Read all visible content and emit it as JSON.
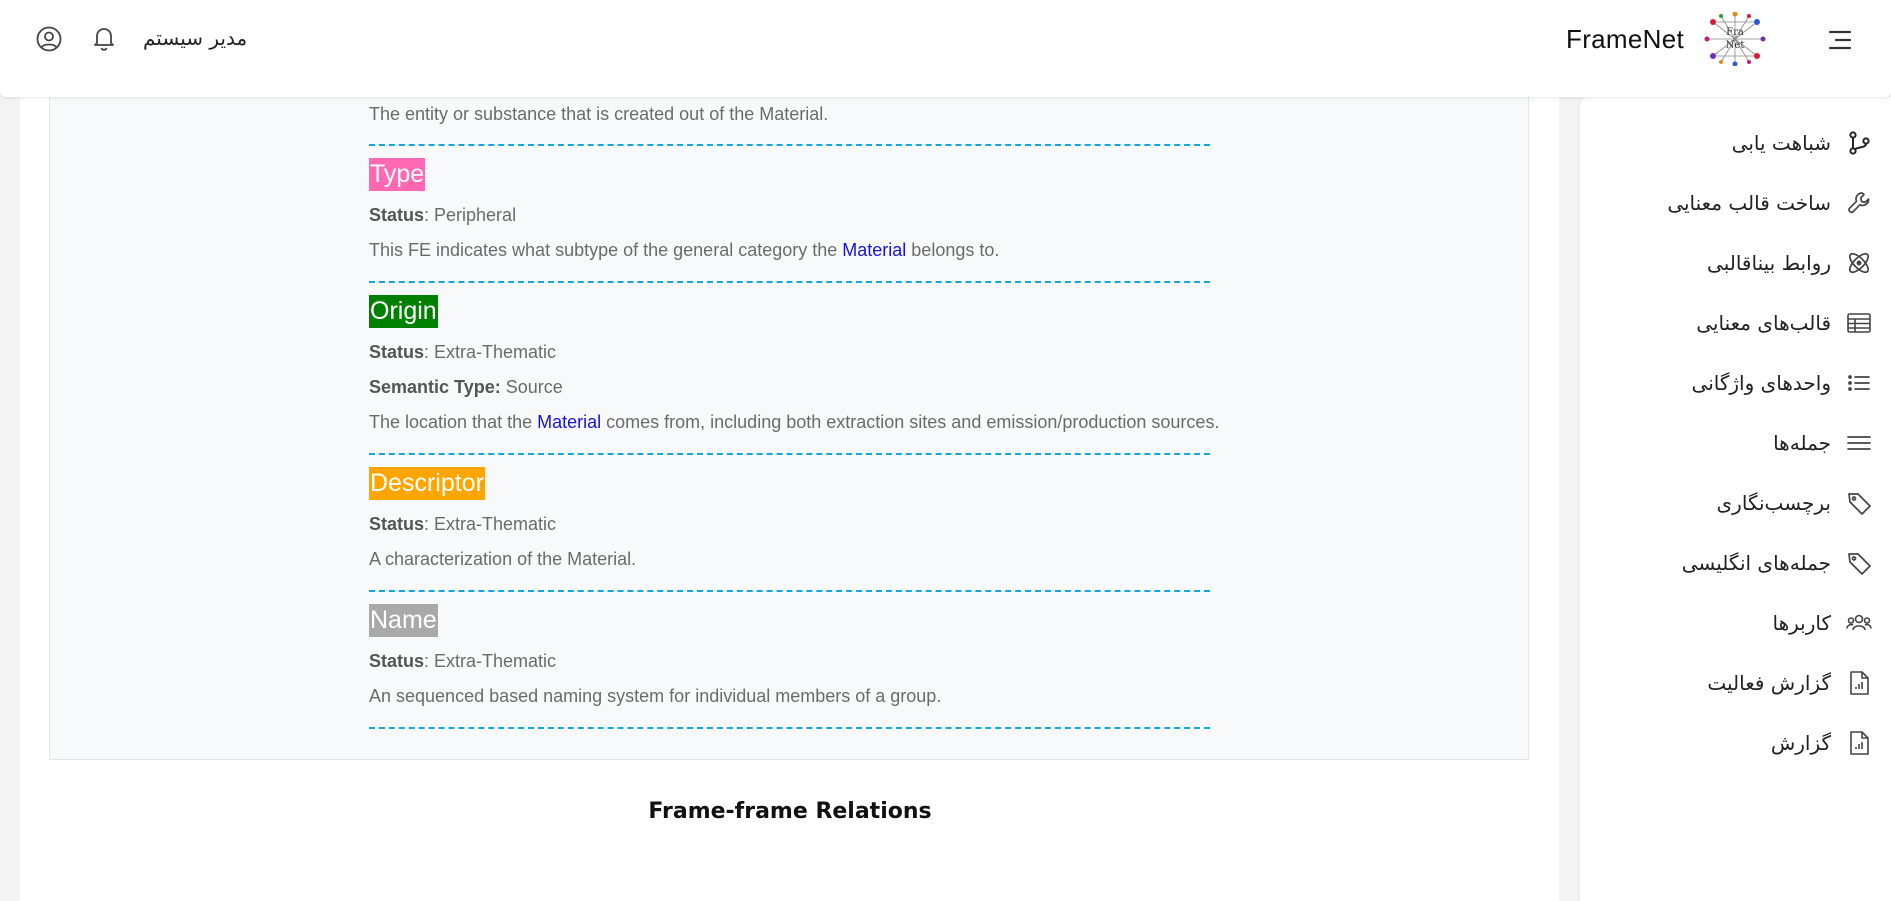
{
  "header": {
    "brand": "FrameNet",
    "user_name": "مدیر سیستم"
  },
  "sidebar": {
    "items": [
      {
        "label": "شباهت یابی",
        "icon": "branch-icon"
      },
      {
        "label": "ساخت قالب معنایی",
        "icon": "wrench-icon"
      },
      {
        "label": "روابط بیناقالبی",
        "icon": "atom-icon"
      },
      {
        "label": "قالب‌های معنایی",
        "icon": "table-icon"
      },
      {
        "label": "واحدهای واژگانی",
        "icon": "list-icon"
      },
      {
        "label": "جمله‌ها",
        "icon": "lines-icon"
      },
      {
        "label": "برچسب‌نگاری",
        "icon": "tag-icon"
      },
      {
        "label": "جمله‌های انگلیسی",
        "icon": "tag-icon"
      },
      {
        "label": "کاربرها",
        "icon": "users-icon"
      },
      {
        "label": "گزارش فعالیت",
        "icon": "report-icon"
      },
      {
        "label": "گزارش",
        "icon": "report-icon"
      }
    ]
  },
  "frame_elements": {
    "top_desc": "The entity or substance that is created out of the Material.",
    "status_key": "Status",
    "semtype_key": "Semantic Type:",
    "items": [
      {
        "name": "Type",
        "color": "#ff69b4",
        "status": ": Peripheral",
        "desc_before": "This FE indicates what subtype of the general category the ",
        "link": "Material",
        "desc_after": " belongs to."
      },
      {
        "name": "Origin",
        "color": "#008000",
        "status": ": Extra-Thematic",
        "semantic_type": " Source",
        "desc_before": "The location that the ",
        "link": "Material",
        "desc_after": " comes from, including both extraction sites and emission/production sources."
      },
      {
        "name": "Descriptor",
        "color": "#ffa500",
        "status": ": Extra-Thematic",
        "desc": "A characterization of the Material."
      },
      {
        "name": "Name",
        "color": "#a9a9a9",
        "status": ": Extra-Thematic",
        "desc": "An sequenced based naming system for individual members of a group."
      }
    ]
  },
  "relations_title": "Frame-frame Relations"
}
